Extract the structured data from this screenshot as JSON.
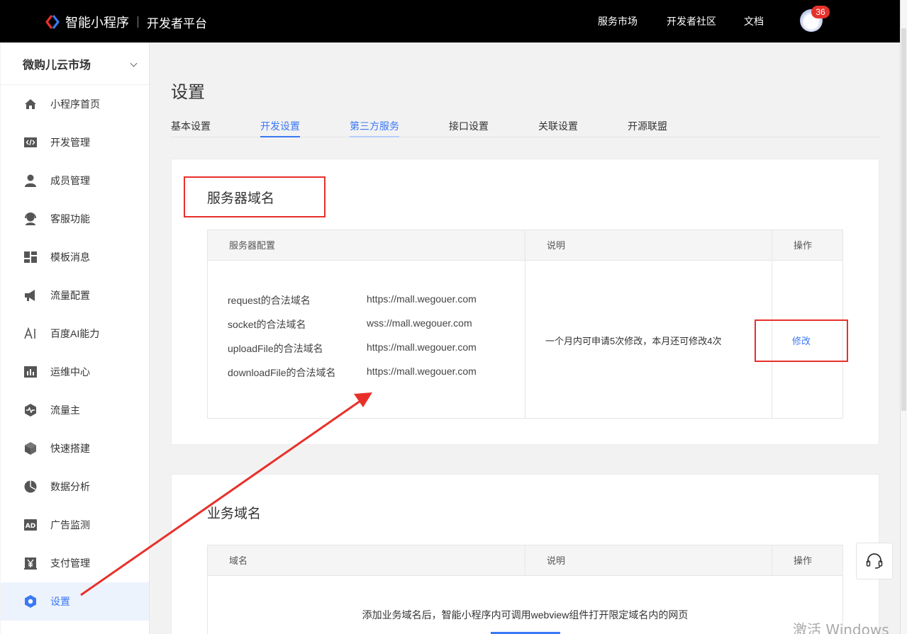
{
  "header": {
    "brand_name": "智能小程序",
    "brand_sub": "开发者平台",
    "nav": [
      "服务市场",
      "开发者社区",
      "文档"
    ],
    "notification_count": "36",
    "accent_color": "#3a78f5"
  },
  "sidebar": {
    "app_name": "微购儿云市场",
    "items": [
      {
        "label": "小程序首页",
        "icon": "home-icon"
      },
      {
        "label": "开发管理",
        "icon": "code-icon"
      },
      {
        "label": "成员管理",
        "icon": "user-icon"
      },
      {
        "label": "客服功能",
        "icon": "headset-icon"
      },
      {
        "label": "模板消息",
        "icon": "template-icon"
      },
      {
        "label": "流量配置",
        "icon": "megaphone-icon"
      },
      {
        "label": "百度AI能力",
        "icon": "ai-icon"
      },
      {
        "label": "运维中心",
        "icon": "bar-chart-icon"
      },
      {
        "label": "流量主",
        "icon": "pulse-icon"
      },
      {
        "label": "快速搭建",
        "icon": "cube-icon"
      },
      {
        "label": "数据分析",
        "icon": "pie-chart-icon"
      },
      {
        "label": "广告监测",
        "icon": "ad-icon"
      },
      {
        "label": "支付管理",
        "icon": "yuan-icon"
      },
      {
        "label": "设置",
        "icon": "settings-icon",
        "active": true
      }
    ]
  },
  "main": {
    "title": "设置",
    "tabs": [
      "基本设置",
      "开发设置",
      "第三方服务",
      "接口设置",
      "关联设置",
      "开源联盟"
    ],
    "active_tab": "开发设置",
    "server_section": {
      "title": "服务器域名",
      "headers": [
        "服务器配置",
        "说明",
        "操作"
      ],
      "rows": [
        {
          "label": "request的合法域名",
          "value": "https://mall.wegouer.com"
        },
        {
          "label": "socket的合法域名",
          "value": "wss://mall.wegouer.com"
        },
        {
          "label": "uploadFile的合法域名",
          "value": "https://mall.wegouer.com"
        },
        {
          "label": "downloadFile的合法域名",
          "value": "https://mall.wegouer.com"
        }
      ],
      "description": "一个月内可申请5次修改，本月还可修改4次",
      "action": "修改"
    },
    "business_section": {
      "title": "业务域名",
      "headers": [
        "域名",
        "说明",
        "操作"
      ],
      "empty_text": "添加业务域名后，智能小程序内可调用webview组件打开限定域名内的网页"
    }
  },
  "watermark": "激活 Windows"
}
